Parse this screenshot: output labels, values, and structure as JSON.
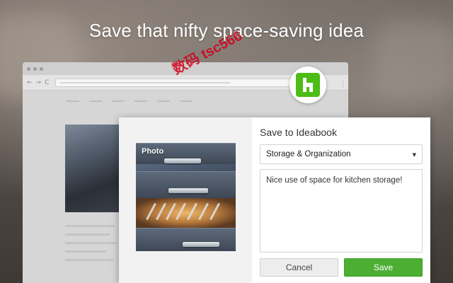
{
  "headline": "Save that nifty space-saving idea",
  "watermark": "数码 tsc566",
  "dialog": {
    "title": "Save to Ideabook",
    "ideabook_select": {
      "selected": "Storage & Organization"
    },
    "comment": "Nice use of space for kitchen storage!",
    "photo_label": "Photo",
    "cancel_label": "Cancel",
    "save_label": "Save"
  },
  "browser": {
    "back_glyph": "←",
    "forward_glyph": "→",
    "reload_glyph": "C"
  },
  "colors": {
    "houzz_green": "#4dbc15",
    "save_green": "#4caf34"
  },
  "icons": {
    "extension": "houzz-logo-icon",
    "select_caret": "caret-down-icon"
  }
}
